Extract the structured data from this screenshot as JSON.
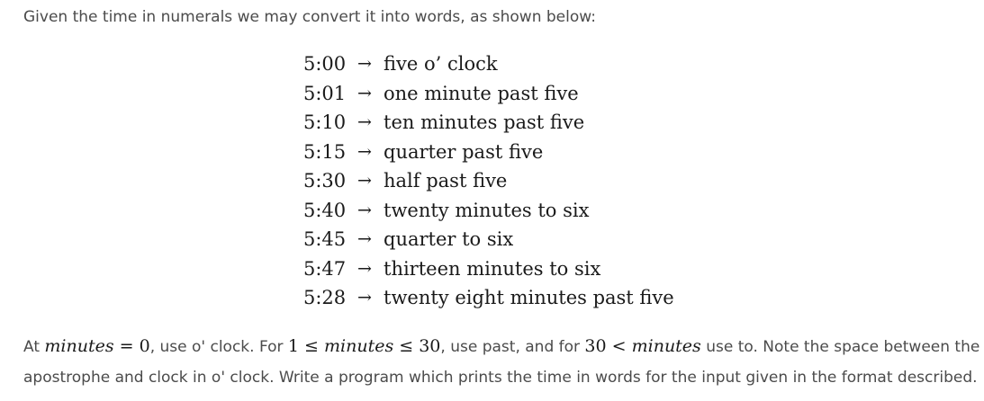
{
  "intro": "Given the time in numerals we may convert it into words, as shown below:",
  "arrow": "→",
  "examples": [
    {
      "time": "5:00",
      "words": "five o’ clock"
    },
    {
      "time": "5:01",
      "words": "one minute past five"
    },
    {
      "time": "5:10",
      "words": "ten minutes past five"
    },
    {
      "time": "5:15",
      "words": "quarter past five"
    },
    {
      "time": "5:30",
      "words": "half past five"
    },
    {
      "time": "5:40",
      "words": "twenty minutes to six"
    },
    {
      "time": "5:45",
      "words": "quarter to six"
    },
    {
      "time": "5:47",
      "words": "thirteen minutes to six"
    },
    {
      "time": "5:28",
      "words": "twenty eight minutes past five"
    }
  ],
  "explanation": {
    "t1": "At ",
    "m1_var": "minutes",
    "m1_op": " = 0",
    "t2": ", use o' clock. For ",
    "m2_pre": "1 ≤ ",
    "m2_var": "minutes",
    "m2_post": " ≤ 30",
    "t3": ", use past, and for ",
    "m3_pre": "30 < ",
    "m3_var": "minutes",
    "t4": " use to. Note the space between the",
    "line2": "apostrophe and clock in o' clock. Write a program which prints the time in words for the input given in the format described."
  }
}
